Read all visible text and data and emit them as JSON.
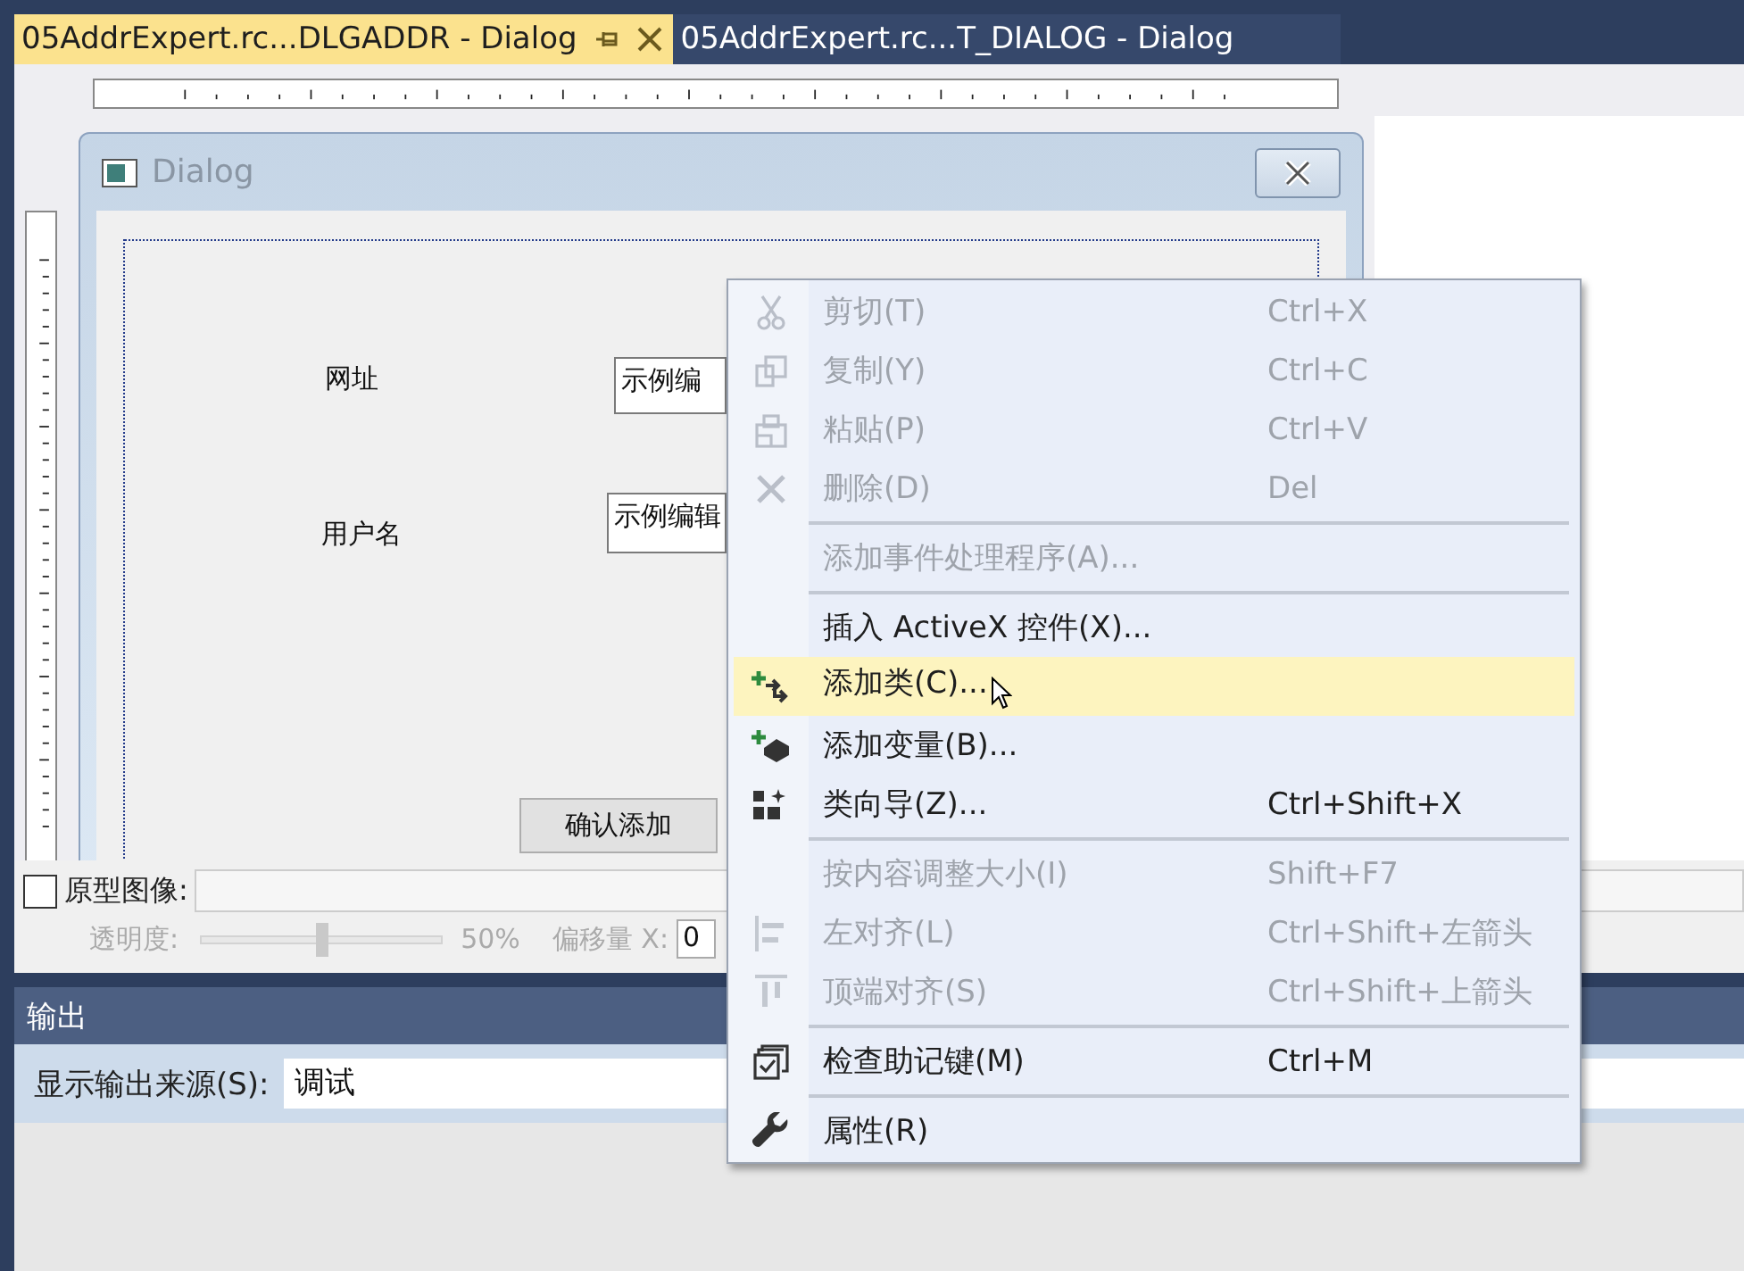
{
  "tabs": [
    {
      "label": "05AddrExpert.rc...DLGADDR - Dialog",
      "selected": true
    },
    {
      "label": "05AddrExpert.rc...T_DIALOG - Dialog",
      "selected": false
    }
  ],
  "dialog": {
    "title": "Dialog",
    "controls": [
      {
        "kind": "label",
        "text": "网址"
      },
      {
        "kind": "edit",
        "text": "示例编"
      },
      {
        "kind": "label",
        "text": "用户名"
      },
      {
        "kind": "edit",
        "text": "示例编辑"
      },
      {
        "kind": "button",
        "text": "确认添加"
      }
    ]
  },
  "overlay": {
    "checkbox": {
      "label": "原型图像:",
      "checked": false
    },
    "opacity": {
      "label": "透明度:",
      "level": 0.5,
      "reading": "50%"
    },
    "offset_x": {
      "label": "偏移量 X:",
      "value": "0"
    }
  },
  "output": {
    "title": "输出",
    "source_label": "显示输出来源(S):",
    "source_value": "调试"
  },
  "context_menu": [
    {
      "kind": "item",
      "label": "剪切(T)",
      "shortcut": "Ctrl+X",
      "disabled": true,
      "selected": false
    },
    {
      "kind": "item",
      "label": "复制(Y)",
      "shortcut": "Ctrl+C",
      "disabled": true,
      "selected": false
    },
    {
      "kind": "item",
      "label": "粘贴(P)",
      "shortcut": "Ctrl+V",
      "disabled": true,
      "selected": false
    },
    {
      "kind": "item",
      "label": "删除(D)",
      "shortcut": "Del",
      "disabled": true,
      "selected": false
    },
    {
      "kind": "separator"
    },
    {
      "kind": "item",
      "label": "添加事件处理程序(A)...",
      "disabled": true,
      "selected": false
    },
    {
      "kind": "separator"
    },
    {
      "kind": "item",
      "label": "插入 ActiveX 控件(X)...",
      "disabled": false,
      "selected": false
    },
    {
      "kind": "item",
      "label": "添加类(C)...",
      "disabled": false,
      "selected": true
    },
    {
      "kind": "item",
      "label": "添加变量(B)...",
      "disabled": false,
      "selected": false
    },
    {
      "kind": "item",
      "label": "类向导(Z)...",
      "shortcut": "Ctrl+Shift+X",
      "disabled": false,
      "selected": false
    },
    {
      "kind": "separator"
    },
    {
      "kind": "item",
      "label": "按内容调整大小(I)",
      "shortcut": "Shift+F7",
      "disabled": true,
      "selected": false
    },
    {
      "kind": "item",
      "label": "左对齐(L)",
      "shortcut": "Ctrl+Shift+左箭头",
      "disabled": true,
      "selected": false
    },
    {
      "kind": "item",
      "label": "顶端对齐(S)",
      "shortcut": "Ctrl+Shift+上箭头",
      "disabled": true,
      "selected": false
    },
    {
      "kind": "separator"
    },
    {
      "kind": "item",
      "label": "检查助记键(M)",
      "shortcut": "Ctrl+M",
      "disabled": false,
      "selected": false
    },
    {
      "kind": "separator"
    },
    {
      "kind": "item",
      "label": "属性(R)",
      "disabled": false,
      "selected": false
    }
  ]
}
